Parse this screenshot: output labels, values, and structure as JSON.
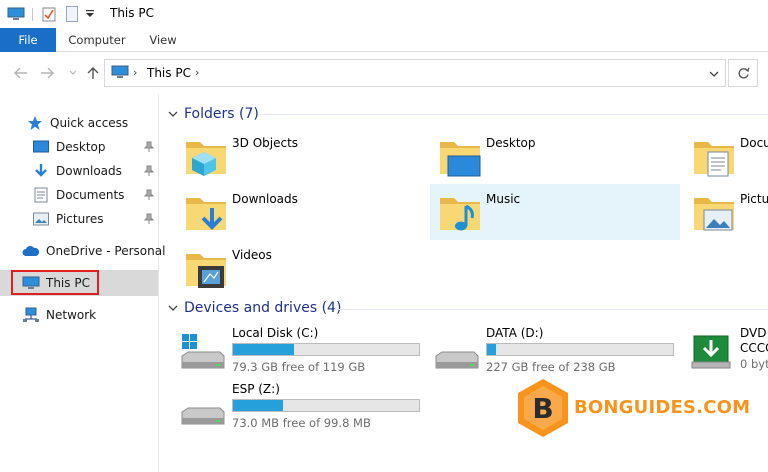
{
  "window": {
    "title": "This PC"
  },
  "ribbon": {
    "tabs": [
      "File",
      "Computer",
      "View"
    ]
  },
  "address": {
    "crumb": "This PC"
  },
  "sidebar": {
    "quick_access": "Quick access",
    "items": [
      {
        "label": "Desktop",
        "icon": "desktop-icon"
      },
      {
        "label": "Downloads",
        "icon": "downloads-icon"
      },
      {
        "label": "Documents",
        "icon": "documents-icon"
      },
      {
        "label": "Pictures",
        "icon": "pictures-icon"
      }
    ],
    "onedrive": "OneDrive - Personal",
    "this_pc": "This PC",
    "network": "Network"
  },
  "folders": {
    "header": "Folders (7)",
    "items": [
      {
        "name": "3D Objects"
      },
      {
        "name": "Desktop"
      },
      {
        "name": "Docu"
      },
      {
        "name": "Downloads"
      },
      {
        "name": "Music"
      },
      {
        "name": "Pictu"
      },
      {
        "name": "Videos"
      }
    ]
  },
  "drives": {
    "header": "Devices and drives (4)",
    "items": [
      {
        "name": "Local Disk (C:)",
        "free": "79.3 GB free of 119 GB",
        "used_fraction": 0.33
      },
      {
        "name": "DATA (D:)",
        "free": "227 GB free of 238 GB",
        "used_fraction": 0.046
      },
      {
        "name": "ESP (Z:)",
        "free": "73.0 MB free of 99.8 MB",
        "used_fraction": 0.27
      }
    ],
    "dvd": {
      "line1": "DVD I",
      "line2": "CCCC",
      "line3": "0 byt"
    }
  },
  "watermark": {
    "text": "BONGUIDES.COM",
    "letter": "B"
  },
  "colors": {
    "accent": "#1a6ec6",
    "header_text": "#1e3287",
    "bar_fill": "#26a0da",
    "folder_yellow": "#f8d775",
    "highlight": "#e02020",
    "watermark": "#f7941d"
  }
}
